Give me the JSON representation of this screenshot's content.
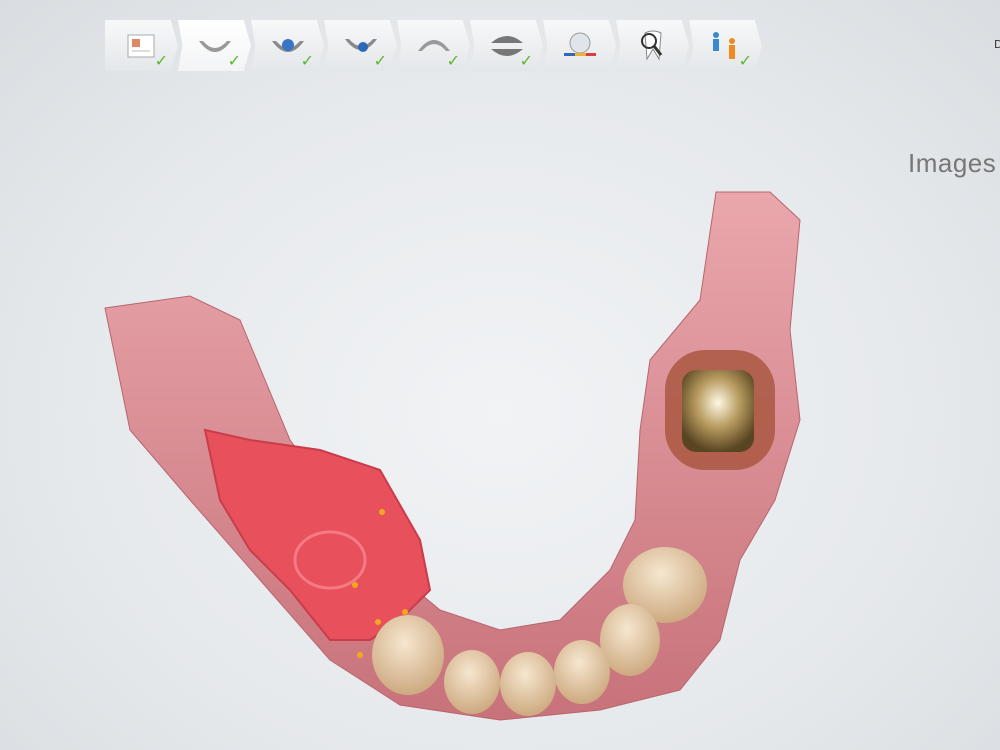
{
  "workflow_steps": [
    {
      "icon": "order-form-icon",
      "checked": true,
      "active": false
    },
    {
      "icon": "lower-jaw-scan-icon",
      "checked": true,
      "active": true
    },
    {
      "icon": "jaw-scan-blue-icon",
      "checked": true,
      "active": false
    },
    {
      "icon": "jaw-scan-rotated-icon",
      "checked": true,
      "active": false
    },
    {
      "icon": "upper-jaw-scan-icon",
      "checked": true,
      "active": false
    },
    {
      "icon": "bite-scan-icon",
      "checked": true,
      "active": false
    },
    {
      "icon": "tooth-analysis-icon",
      "checked": false,
      "active": false
    },
    {
      "icon": "tooth-magnifier-icon",
      "checked": false,
      "active": false
    },
    {
      "icon": "send-to-lab-icon",
      "checked": true,
      "active": false
    }
  ],
  "check_glyph": "✓",
  "corner_label": "D",
  "images_label": "Images",
  "colors": {
    "check": "#5cb82d",
    "gum": "#d98890",
    "teeth": "#e8cfa9",
    "impression": "#e8505c",
    "metal": "#8a7040"
  }
}
